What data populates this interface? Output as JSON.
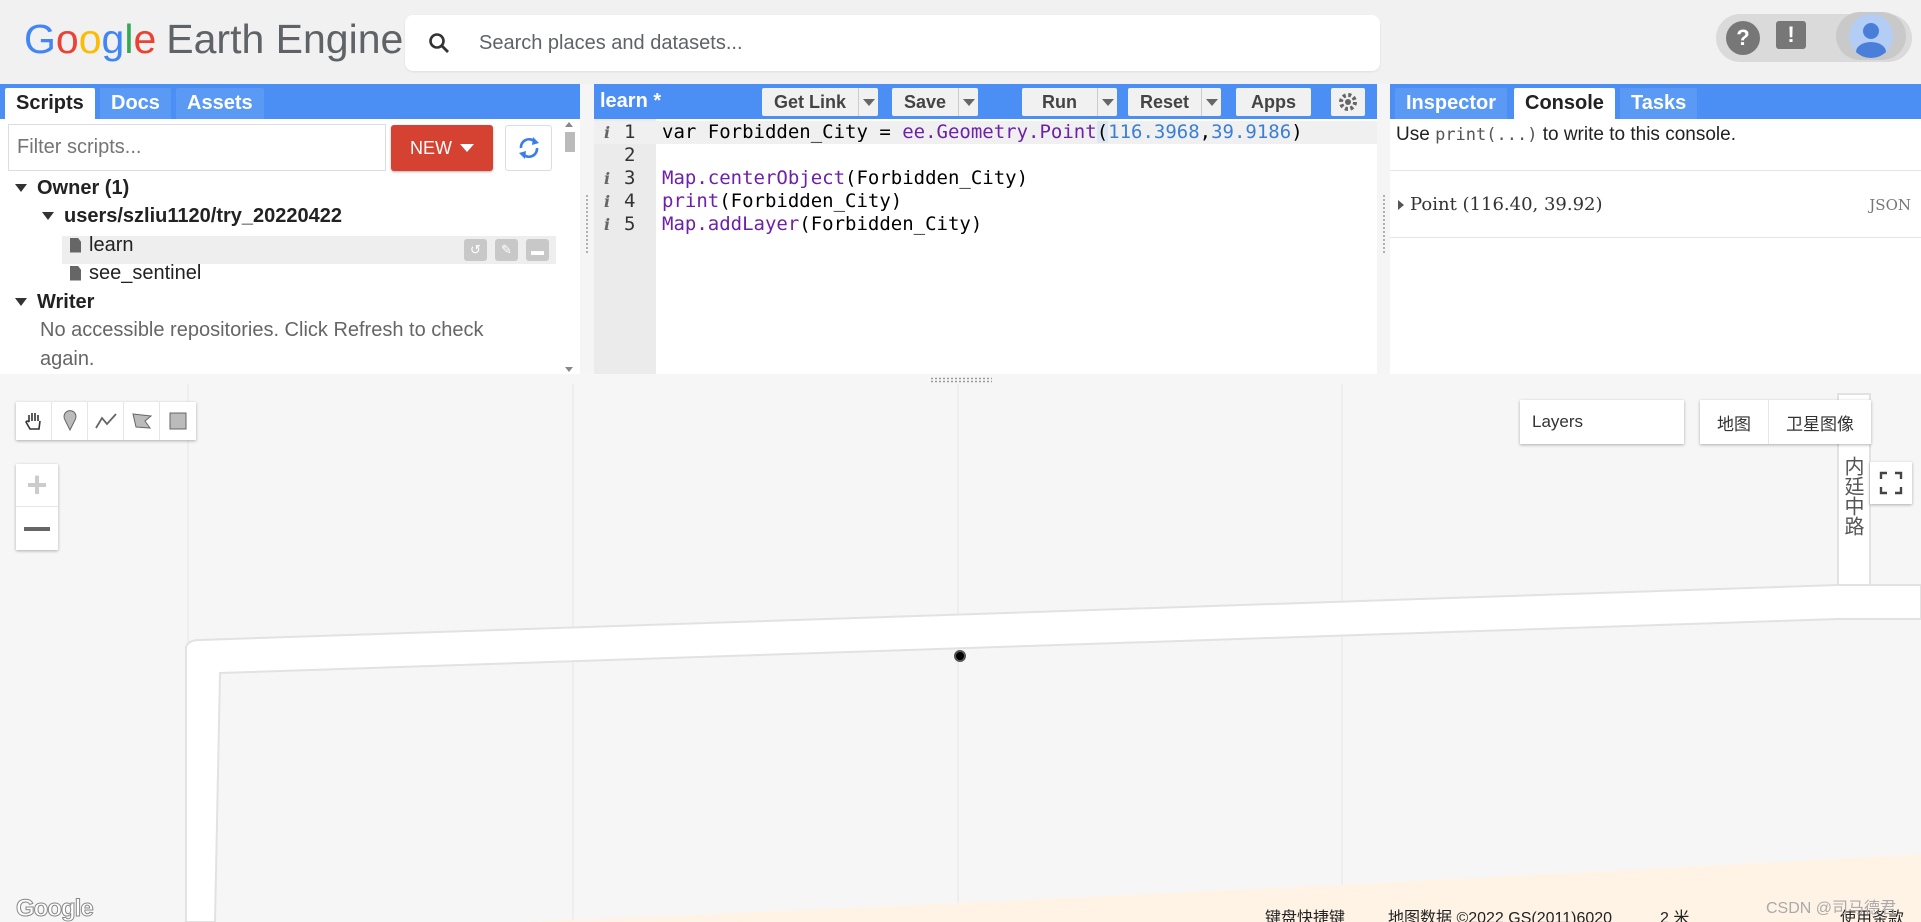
{
  "header": {
    "logo_google": [
      "G",
      "o",
      "o",
      "g",
      "l",
      "e"
    ],
    "logo_product": "Earth Engine",
    "search_placeholder": "Search places and datasets...",
    "icons": [
      "help-icon",
      "feedback-icon",
      "avatar"
    ]
  },
  "left_panel": {
    "tabs": [
      "Scripts",
      "Docs",
      "Assets"
    ],
    "active_tab": "Scripts",
    "filter_placeholder": "Filter scripts...",
    "new_button": "NEW",
    "tree": {
      "owner": "Owner (1)",
      "repo": "users/szliu1120/try_20220422",
      "files": [
        "learn",
        "see_sentinel"
      ],
      "writer": "Writer",
      "writer_msg_1": "No accessible repositories. Click Refresh to check",
      "writer_msg_2": "again."
    }
  },
  "editor": {
    "title": "learn *",
    "buttons": {
      "get_link": "Get Link",
      "save": "Save",
      "run": "Run",
      "reset": "Reset",
      "apps": "Apps"
    },
    "lines": [
      {
        "num": "1",
        "info": true
      },
      {
        "num": "2",
        "info": false
      },
      {
        "num": "3",
        "info": true
      },
      {
        "num": "4",
        "info": true
      },
      {
        "num": "5",
        "info": true
      }
    ],
    "code": {
      "l1_a": "var Forbidden_City = ",
      "l1_b": "ee.Geometry.Point",
      "l1_c": "(",
      "l1_d": "116.3968",
      "l1_e": ",",
      "l1_f": "39.9186",
      "l1_g": ")",
      "l3_a": "Map.centerObject",
      "l3_b": "(Forbidden_City)",
      "l4_a": "print",
      "l4_b": "(Forbidden_City)",
      "l5_a": "Map.addLayer",
      "l5_b": "(Forbidden_City)"
    }
  },
  "right_panel": {
    "tabs": [
      "Inspector",
      "Console",
      "Tasks"
    ],
    "active_tab": "Console",
    "msg_a": "Use ",
    "msg_code": "print(...)",
    "msg_b": " to write to this console.",
    "output": "Point (116.40, 39.92)",
    "json_label": "JSON"
  },
  "map": {
    "layers_label": "Layers",
    "map_type": [
      "地图",
      "卫星图像"
    ],
    "road_label": "内廷中路",
    "watermark": "Google",
    "attrib": [
      "键盘快捷键",
      "地图数据 ©2022 GS(2011)6020",
      "2 米",
      "使用条款"
    ],
    "csdn": "CSDN @司马德君"
  }
}
